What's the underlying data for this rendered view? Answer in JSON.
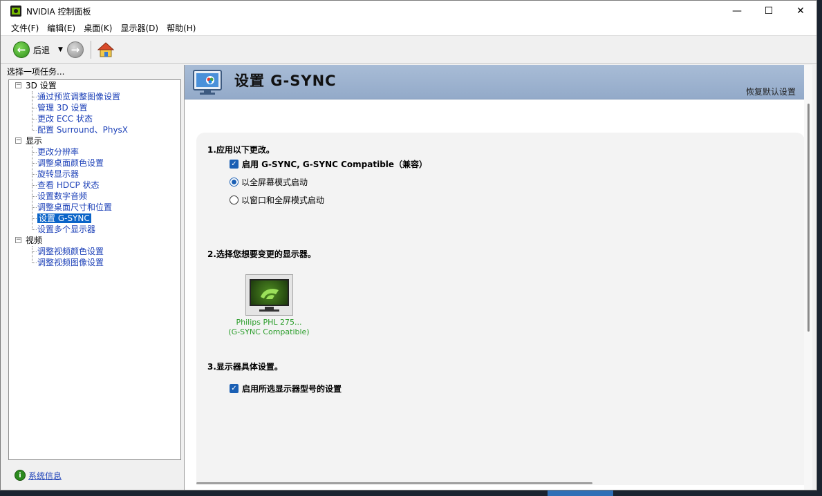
{
  "window": {
    "title": "NVIDIA 控制面板",
    "controls": {
      "minimize": "—",
      "maximize": "☐",
      "close": "✕"
    }
  },
  "menu": [
    "文件(F)",
    "编辑(E)",
    "桌面(K)",
    "显示器(D)",
    "帮助(H)"
  ],
  "toolbar": {
    "back_label": "后退"
  },
  "left_panel": {
    "header": "选择一项任务...",
    "tree": [
      {
        "label": "3D 设置",
        "children": [
          "通过预览调整图像设置",
          "管理 3D 设置",
          "更改 ECC 状态",
          "配置 Surround、PhysX"
        ]
      },
      {
        "label": "显示",
        "children": [
          "更改分辨率",
          "调整桌面颜色设置",
          "旋转显示器",
          "查看 HDCP 状态",
          "设置数字音频",
          "调整桌面尺寸和位置",
          "设置 G-SYNC",
          "设置多个显示器"
        ]
      },
      {
        "label": "视频",
        "children": [
          "调整视频颜色设置",
          "调整视频图像设置"
        ]
      }
    ],
    "selected": "设置 G-SYNC",
    "system_info": "系统信息"
  },
  "page": {
    "title": "设置 G-SYNC",
    "restore_defaults": "恢复默认设置",
    "section1": {
      "title": "1.应用以下更改。",
      "enable_checkbox": "启用 G-SYNC, G-SYNC Compatible（兼容）",
      "enable_checked": true,
      "radio_fullscreen": "以全屏幕模式启动",
      "radio_windowed": "以窗口和全屏模式启动",
      "selected_mode": "fullscreen"
    },
    "section2": {
      "title": "2.选择您想要变更的显示器。",
      "monitor_name": "Philips PHL 275...",
      "monitor_sub": "(G-SYNC Compatible)"
    },
    "section3": {
      "title": "3.显示器具体设置。",
      "model_checkbox": "启用所选显示器型号的设置",
      "model_checked": true
    }
  },
  "colors": {
    "nvidia_green": "#76b900",
    "link_blue": "#1d41b8",
    "selection_blue": "#0a64c8",
    "banner_blue": "#a8bcd6",
    "monitor_label_green": "#2a9d2a"
  }
}
